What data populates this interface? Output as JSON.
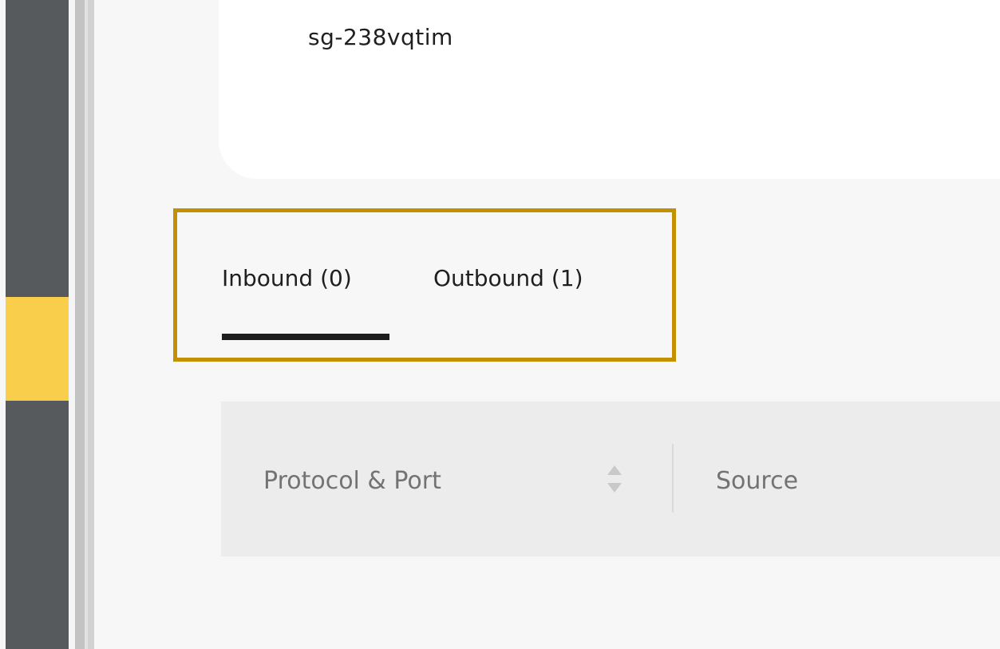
{
  "security_group": {
    "name": "sg-238vqtim"
  },
  "tabs": [
    {
      "label": "Inbound (0)",
      "active": true
    },
    {
      "label": "Outbound (1)",
      "active": false
    }
  ],
  "table": {
    "columns": [
      {
        "label": "Protocol & Port",
        "sortable": true
      },
      {
        "label": "Source",
        "sortable": false
      }
    ]
  },
  "colors": {
    "rail": "#575a5c",
    "rail_active": "#f9ce4a",
    "highlight": "#c29000",
    "tab_underline": "#1e1e1e",
    "table_header_bg": "#ececec"
  },
  "icons": {
    "sort": "sort-up-down-icon"
  }
}
